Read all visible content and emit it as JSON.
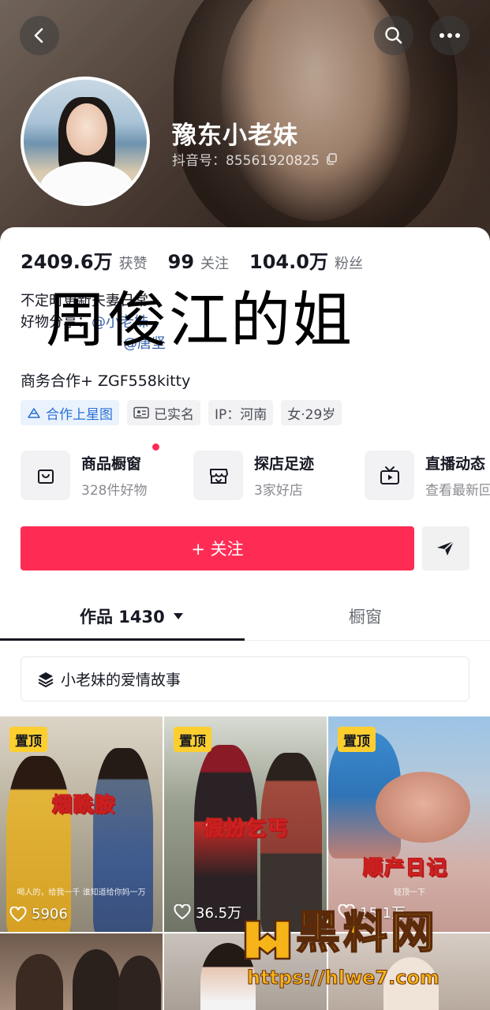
{
  "header": {
    "username": "豫东小老妹",
    "douyin_id": "抖音号：85561920825"
  },
  "stats": [
    {
      "value": "2409.6万",
      "label": "获赞"
    },
    {
      "value": "99",
      "label": "关注"
    },
    {
      "value": "104.0万",
      "label": "粉丝"
    }
  ],
  "bio": {
    "line1": "不定时更新夫妻日常",
    "line2_prefix": "好物分享：",
    "line2_mention": "@小老妹",
    "line3_mention": "@唐坚",
    "overlay_text": "周俊江的姐",
    "business": "商务合作+ ZGF558kitty"
  },
  "tags": [
    "合作上星图",
    "已实名",
    "IP：河南",
    "女·29岁"
  ],
  "services": [
    {
      "title": "商品橱窗",
      "subtitle": "328件好物",
      "icon": "shopping-bag-icon"
    },
    {
      "title": "探店足迹",
      "subtitle": "3家好店",
      "icon": "store-icon"
    },
    {
      "title": "直播动态",
      "subtitle": "查看最新回放",
      "icon": "tv-icon"
    }
  ],
  "actions": {
    "follow_label": "+ 关注"
  },
  "tabs": {
    "works": "作品 1430",
    "window": "橱窗"
  },
  "collection": {
    "label": "小老妹的爱情故事"
  },
  "videos": [
    {
      "pinned": "置顶",
      "caption": "烟酰胺",
      "likes": "5906",
      "subtitle": "喝人的，给我一千 谁知道给你妈一万"
    },
    {
      "pinned": "置顶",
      "caption": "假扮乞丐",
      "likes": "36.5万"
    },
    {
      "pinned": "置顶",
      "caption": "顺产日记",
      "likes": "15.1万",
      "subtitle": "轻顶一下"
    }
  ],
  "watermark": {
    "title": "黑料网",
    "url": "https://hlwe7.com"
  },
  "colors": {
    "accent": "#fe2c55",
    "pin_badge": "#fccf2f",
    "star_tag": "#2a71d4",
    "watermark": "#f6b418"
  }
}
